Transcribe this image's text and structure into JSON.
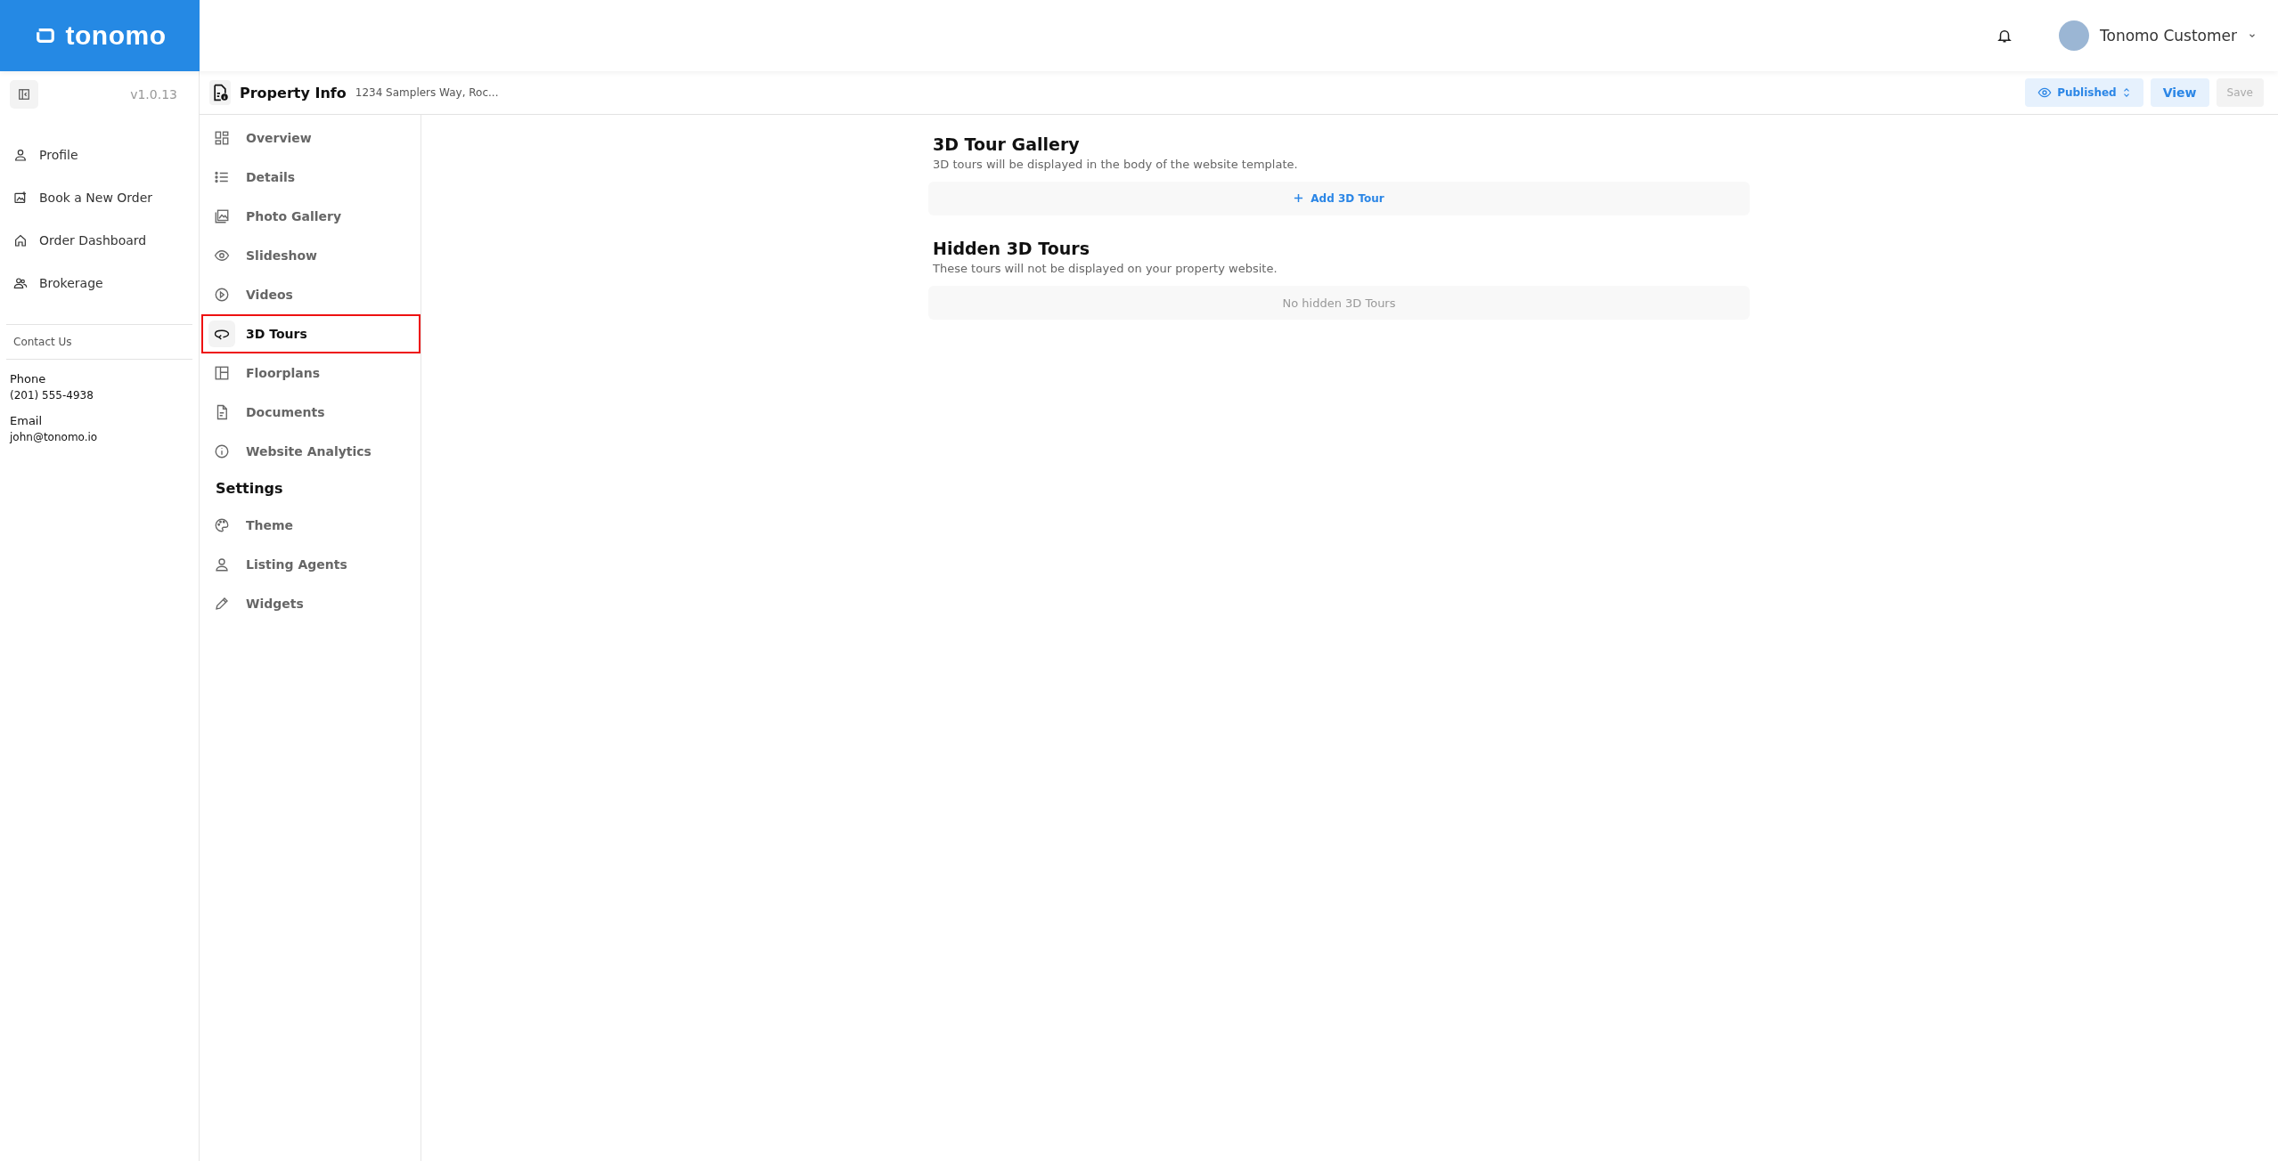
{
  "logo": {
    "text": "tonomo"
  },
  "user": {
    "name": "Tonomo Customer"
  },
  "sidebar": {
    "version": "v1.0.13",
    "items": [
      {
        "label": "Profile"
      },
      {
        "label": "Book a New Order"
      },
      {
        "label": "Order Dashboard"
      },
      {
        "label": "Brokerage"
      }
    ],
    "contact_heading": "Contact Us",
    "contacts": [
      {
        "label": "Phone",
        "value": "(201) 555-4938"
      },
      {
        "label": "Email",
        "value": "john@tonomo.io"
      }
    ]
  },
  "header": {
    "title": "Property Info",
    "address": "1234 Samplers Way, Roc...",
    "status": "Published",
    "view_button": "View",
    "save_button": {
      "label": "Save",
      "disabled": true
    }
  },
  "nav": {
    "items": [
      {
        "label": "Overview",
        "selected": false
      },
      {
        "label": "Details",
        "selected": false
      },
      {
        "label": "Photo Gallery",
        "selected": false
      },
      {
        "label": "Slideshow",
        "selected": false
      },
      {
        "label": "Videos",
        "selected": false
      },
      {
        "label": "3D Tours",
        "selected": true
      },
      {
        "label": "Floorplans",
        "selected": false
      },
      {
        "label": "Documents",
        "selected": false
      },
      {
        "label": "Website Analytics",
        "selected": false
      }
    ],
    "settings_heading": "Settings",
    "settings": [
      {
        "label": "Theme",
        "selected": false
      },
      {
        "label": "Listing Agents",
        "selected": false
      },
      {
        "label": "Widgets",
        "selected": false
      }
    ]
  },
  "gallery": {
    "title": "3D Tour Gallery",
    "description": "3D tours will be displayed in the body of the website template.",
    "add_button": "Add 3D Tour"
  },
  "hidden": {
    "title": "Hidden 3D Tours",
    "description": "These tours will not be displayed on your property website.",
    "empty": "No hidden 3D Tours"
  }
}
